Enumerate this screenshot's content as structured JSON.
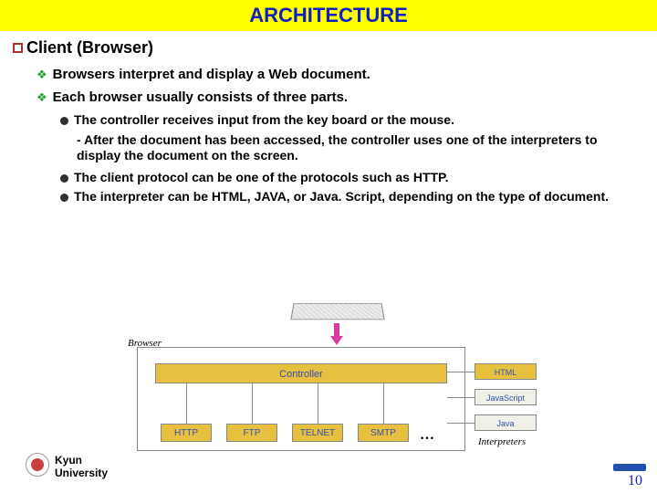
{
  "title": "ARCHITECTURE",
  "section": "Client (Browser)",
  "bullets_lvl2": [
    "Browsers interpret and display a Web document.",
    "Each browser usually consists of three parts."
  ],
  "bullets_lvl3": [
    "The controller receives input from the key board or the mouse.",
    "The client protocol can be one of the protocols such as HTTP.",
    "The interpreter can be HTML, JAVA, or Java. Script, depending on the type of document."
  ],
  "subnote": "- After the document has been accessed, the controller uses one of the  interpreters to display the document on the screen.",
  "diagram": {
    "browser_label": "Browser",
    "controller": "Controller",
    "protocols": [
      "HTTP",
      "FTP",
      "TELNET",
      "SMTP"
    ],
    "ellipsis": "…",
    "interpreters": [
      "HTML",
      "JavaScript",
      "Java"
    ],
    "interpreters_label": "Interpreters"
  },
  "footer": {
    "university_line1": "Kyun",
    "university_line2": "University",
    "page_number": "10"
  }
}
